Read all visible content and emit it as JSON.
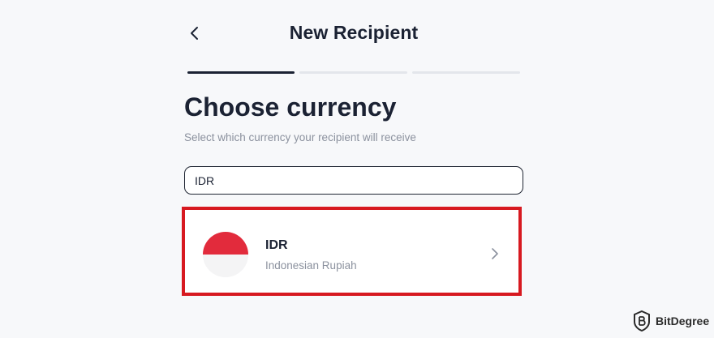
{
  "header": {
    "title": "New Recipient",
    "back_icon": "chevron-left-icon"
  },
  "stepper": {
    "total_steps": 3,
    "current_step": 1
  },
  "main": {
    "heading": "Choose currency",
    "subtitle": "Select which currency your recipient will receive",
    "search": {
      "value": "IDR",
      "placeholder": ""
    },
    "results": [
      {
        "code": "IDR",
        "name": "Indonesian Rupiah",
        "flag": "indonesia-flag-icon",
        "highlighted": true
      }
    ]
  },
  "colors": {
    "text_primary": "#1b2233",
    "text_secondary": "#8b919e",
    "highlight_border": "#d71920",
    "flag_red": "#e22b3c",
    "step_active": "#1b2233",
    "step_inactive": "#e3e6eb"
  },
  "watermark": {
    "text": "BitDegree"
  }
}
